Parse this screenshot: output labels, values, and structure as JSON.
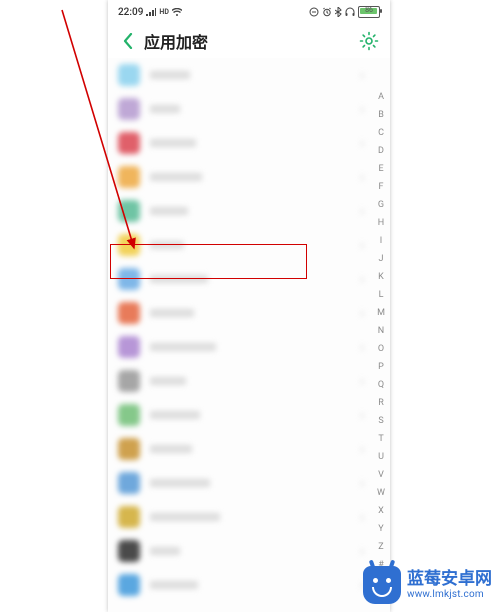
{
  "status": {
    "time": "22:09",
    "battery_percent": 86,
    "battery_text": "86"
  },
  "header": {
    "title": "应用加密"
  },
  "alpha_index": [
    "A",
    "B",
    "C",
    "D",
    "E",
    "F",
    "G",
    "H",
    "I",
    "J",
    "K",
    "L",
    "M",
    "N",
    "O",
    "P",
    "Q",
    "R",
    "S",
    "T",
    "U",
    "V",
    "W",
    "X",
    "Y",
    "Z",
    "#"
  ],
  "rows": [
    {
      "color": "#9ad7f0",
      "w": 40
    },
    {
      "color": "#bfa8d6",
      "w": 30
    },
    {
      "color": "#e0606a",
      "w": 46
    },
    {
      "color": "#f0b55c",
      "w": 52
    },
    {
      "color": "#6fc4a4",
      "w": 38
    },
    {
      "color": "#f2d25a",
      "w": 34
    },
    {
      "color": "#7fb7e8",
      "w": 58
    },
    {
      "color": "#e87b5a",
      "w": 44
    },
    {
      "color": "#b796d7",
      "w": 66
    },
    {
      "color": "#a6a6a6",
      "w": 36
    },
    {
      "color": "#85c88a",
      "w": 50
    },
    {
      "color": "#cfa14e",
      "w": 42
    },
    {
      "color": "#6fa8dc",
      "w": 60
    },
    {
      "color": "#d6b64d",
      "w": 70
    },
    {
      "color": "#4a4a4a",
      "w": 30
    },
    {
      "color": "#5aa7e0",
      "w": 48
    }
  ],
  "watermark": {
    "title": "蓝莓安卓网",
    "url": "www.lmkjst.com"
  },
  "colors": {
    "accent_green": "#23b26a",
    "highlight_red": "#d10000",
    "brand_blue": "#2f6fd1"
  }
}
